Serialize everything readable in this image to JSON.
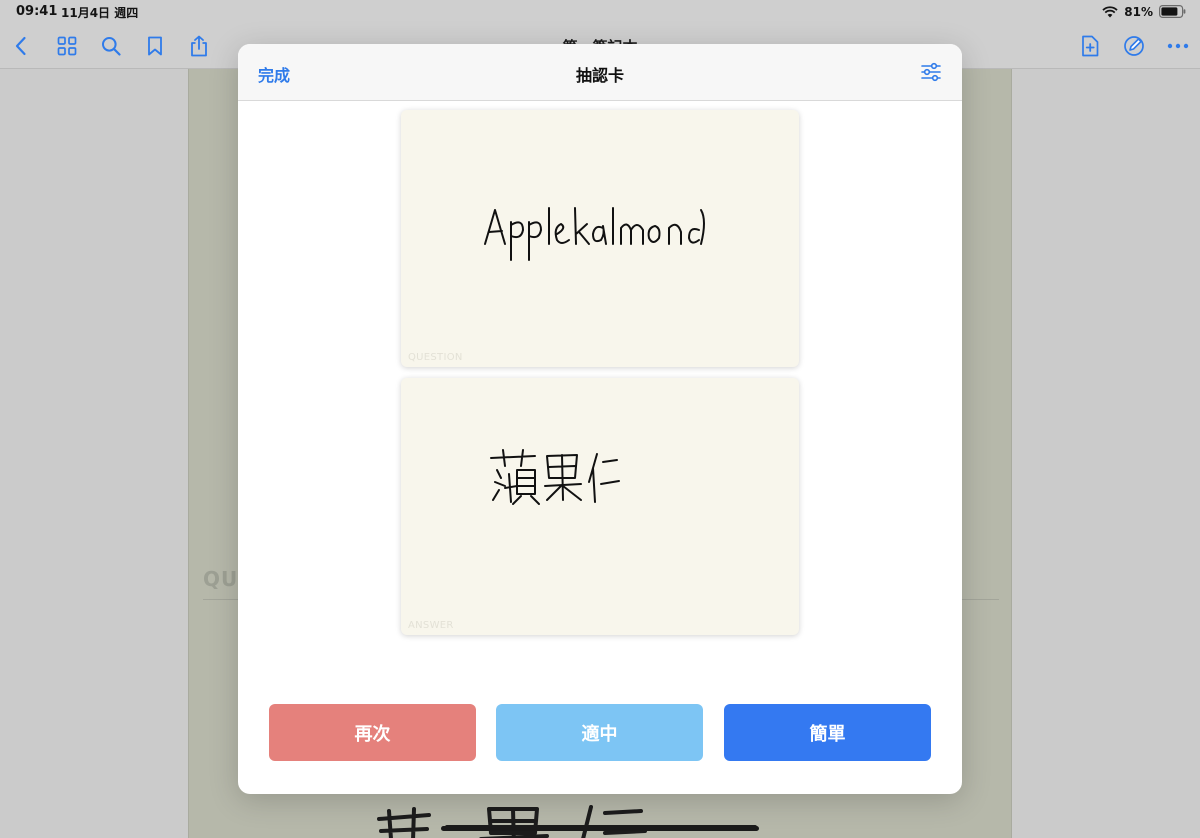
{
  "status_bar": {
    "time": "09:41",
    "date": "11月4日 週四",
    "battery_percent": "81%"
  },
  "toolbar": {
    "document_title": "第一筆記本",
    "icons": [
      "chevron-left-icon",
      "grid-icon",
      "search-icon",
      "bookmark-icon",
      "share-icon",
      "add-page-icon",
      "pencil-circle-icon",
      "more-icon"
    ]
  },
  "notebook": {
    "question_heading": "QU",
    "handwriting_glyphs": "蘋果仁"
  },
  "modal": {
    "done_label": "完成",
    "title": "抽認卡",
    "question_card": {
      "label": "QUESTION",
      "handwriting_text": "Applealmond"
    },
    "answer_card": {
      "label": "ANSWER",
      "handwriting_text": "蘋果仁"
    },
    "buttons": {
      "again_label": "再次",
      "good_label": "適中",
      "easy_label": "簡單"
    }
  },
  "colors": {
    "accent": "#2f7bea",
    "again": "#e5817c",
    "good": "#7dc5f4",
    "easy": "#3479f1",
    "card_background": "#f8f6ec"
  }
}
